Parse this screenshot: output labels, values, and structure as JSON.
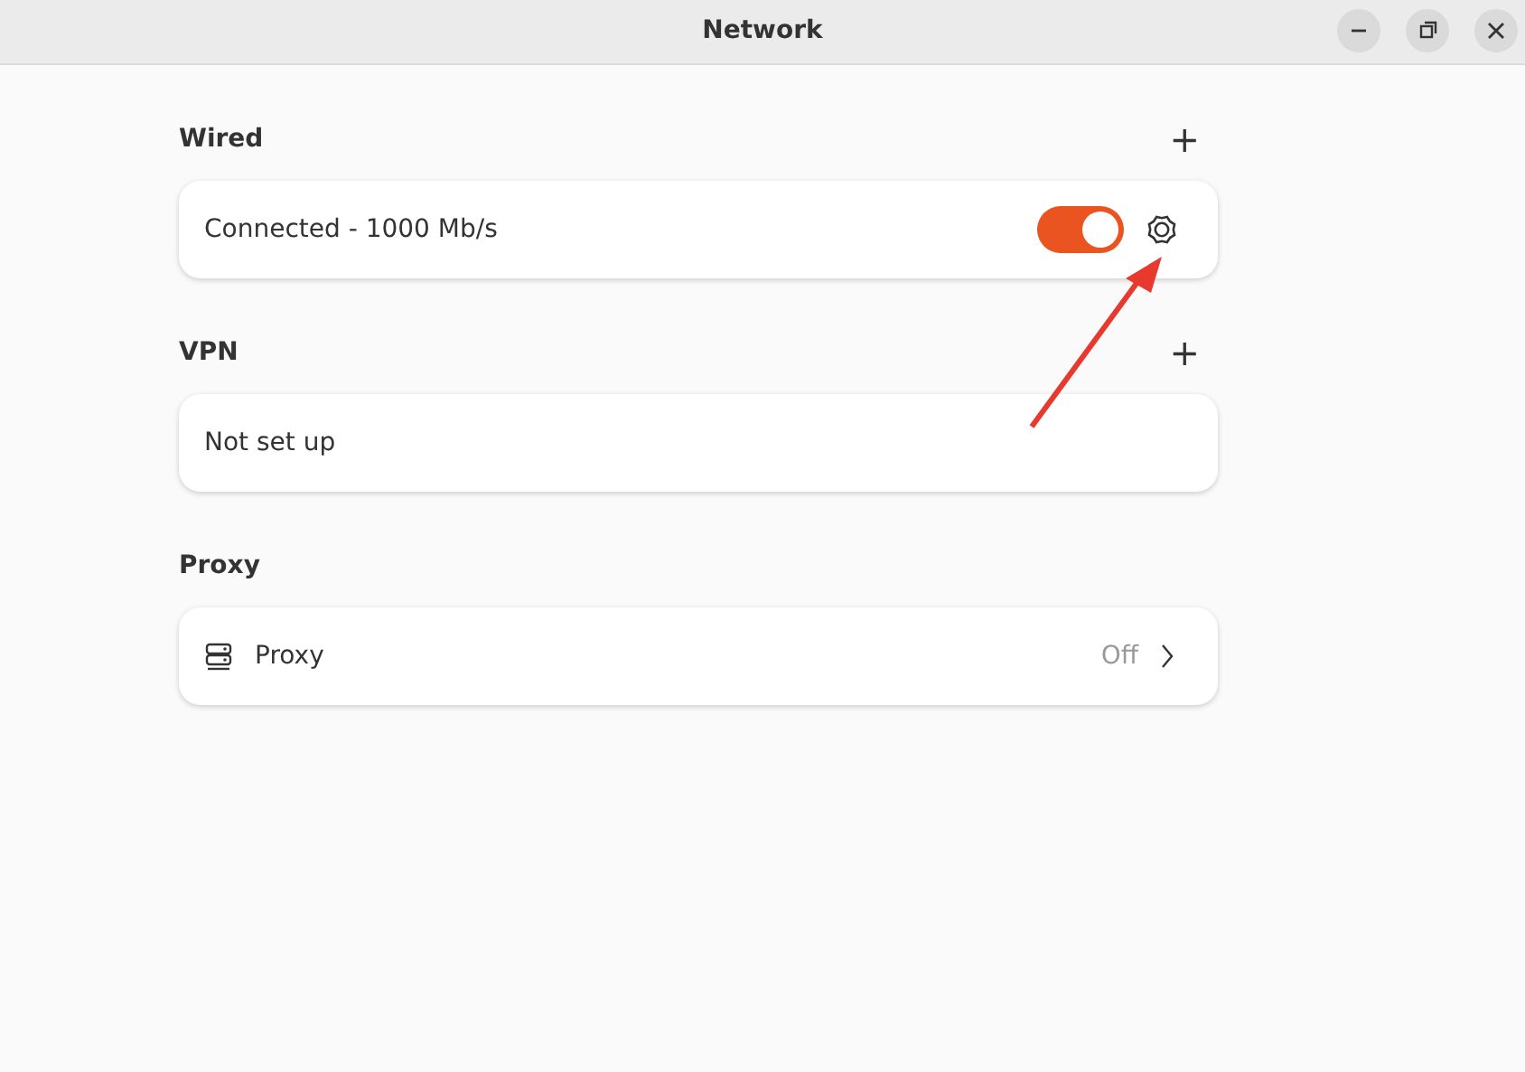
{
  "window": {
    "title": "Network",
    "controls": [
      {
        "kind": "minimize"
      },
      {
        "kind": "maximize"
      },
      {
        "kind": "close"
      }
    ]
  },
  "sections": [
    {
      "title": "Wired",
      "add": "+",
      "rows": [
        {
          "kind": "switch",
          "label": "Connected - 1000 Mb/s",
          "on": true
        }
      ]
    },
    {
      "title": "VPN",
      "add": "+",
      "rows": [
        {
          "kind": "plain",
          "label": "Not set up"
        }
      ]
    },
    {
      "title": "Proxy",
      "rows": [
        {
          "kind": "link",
          "label": "Proxy",
          "value": "Off"
        }
      ]
    }
  ]
}
